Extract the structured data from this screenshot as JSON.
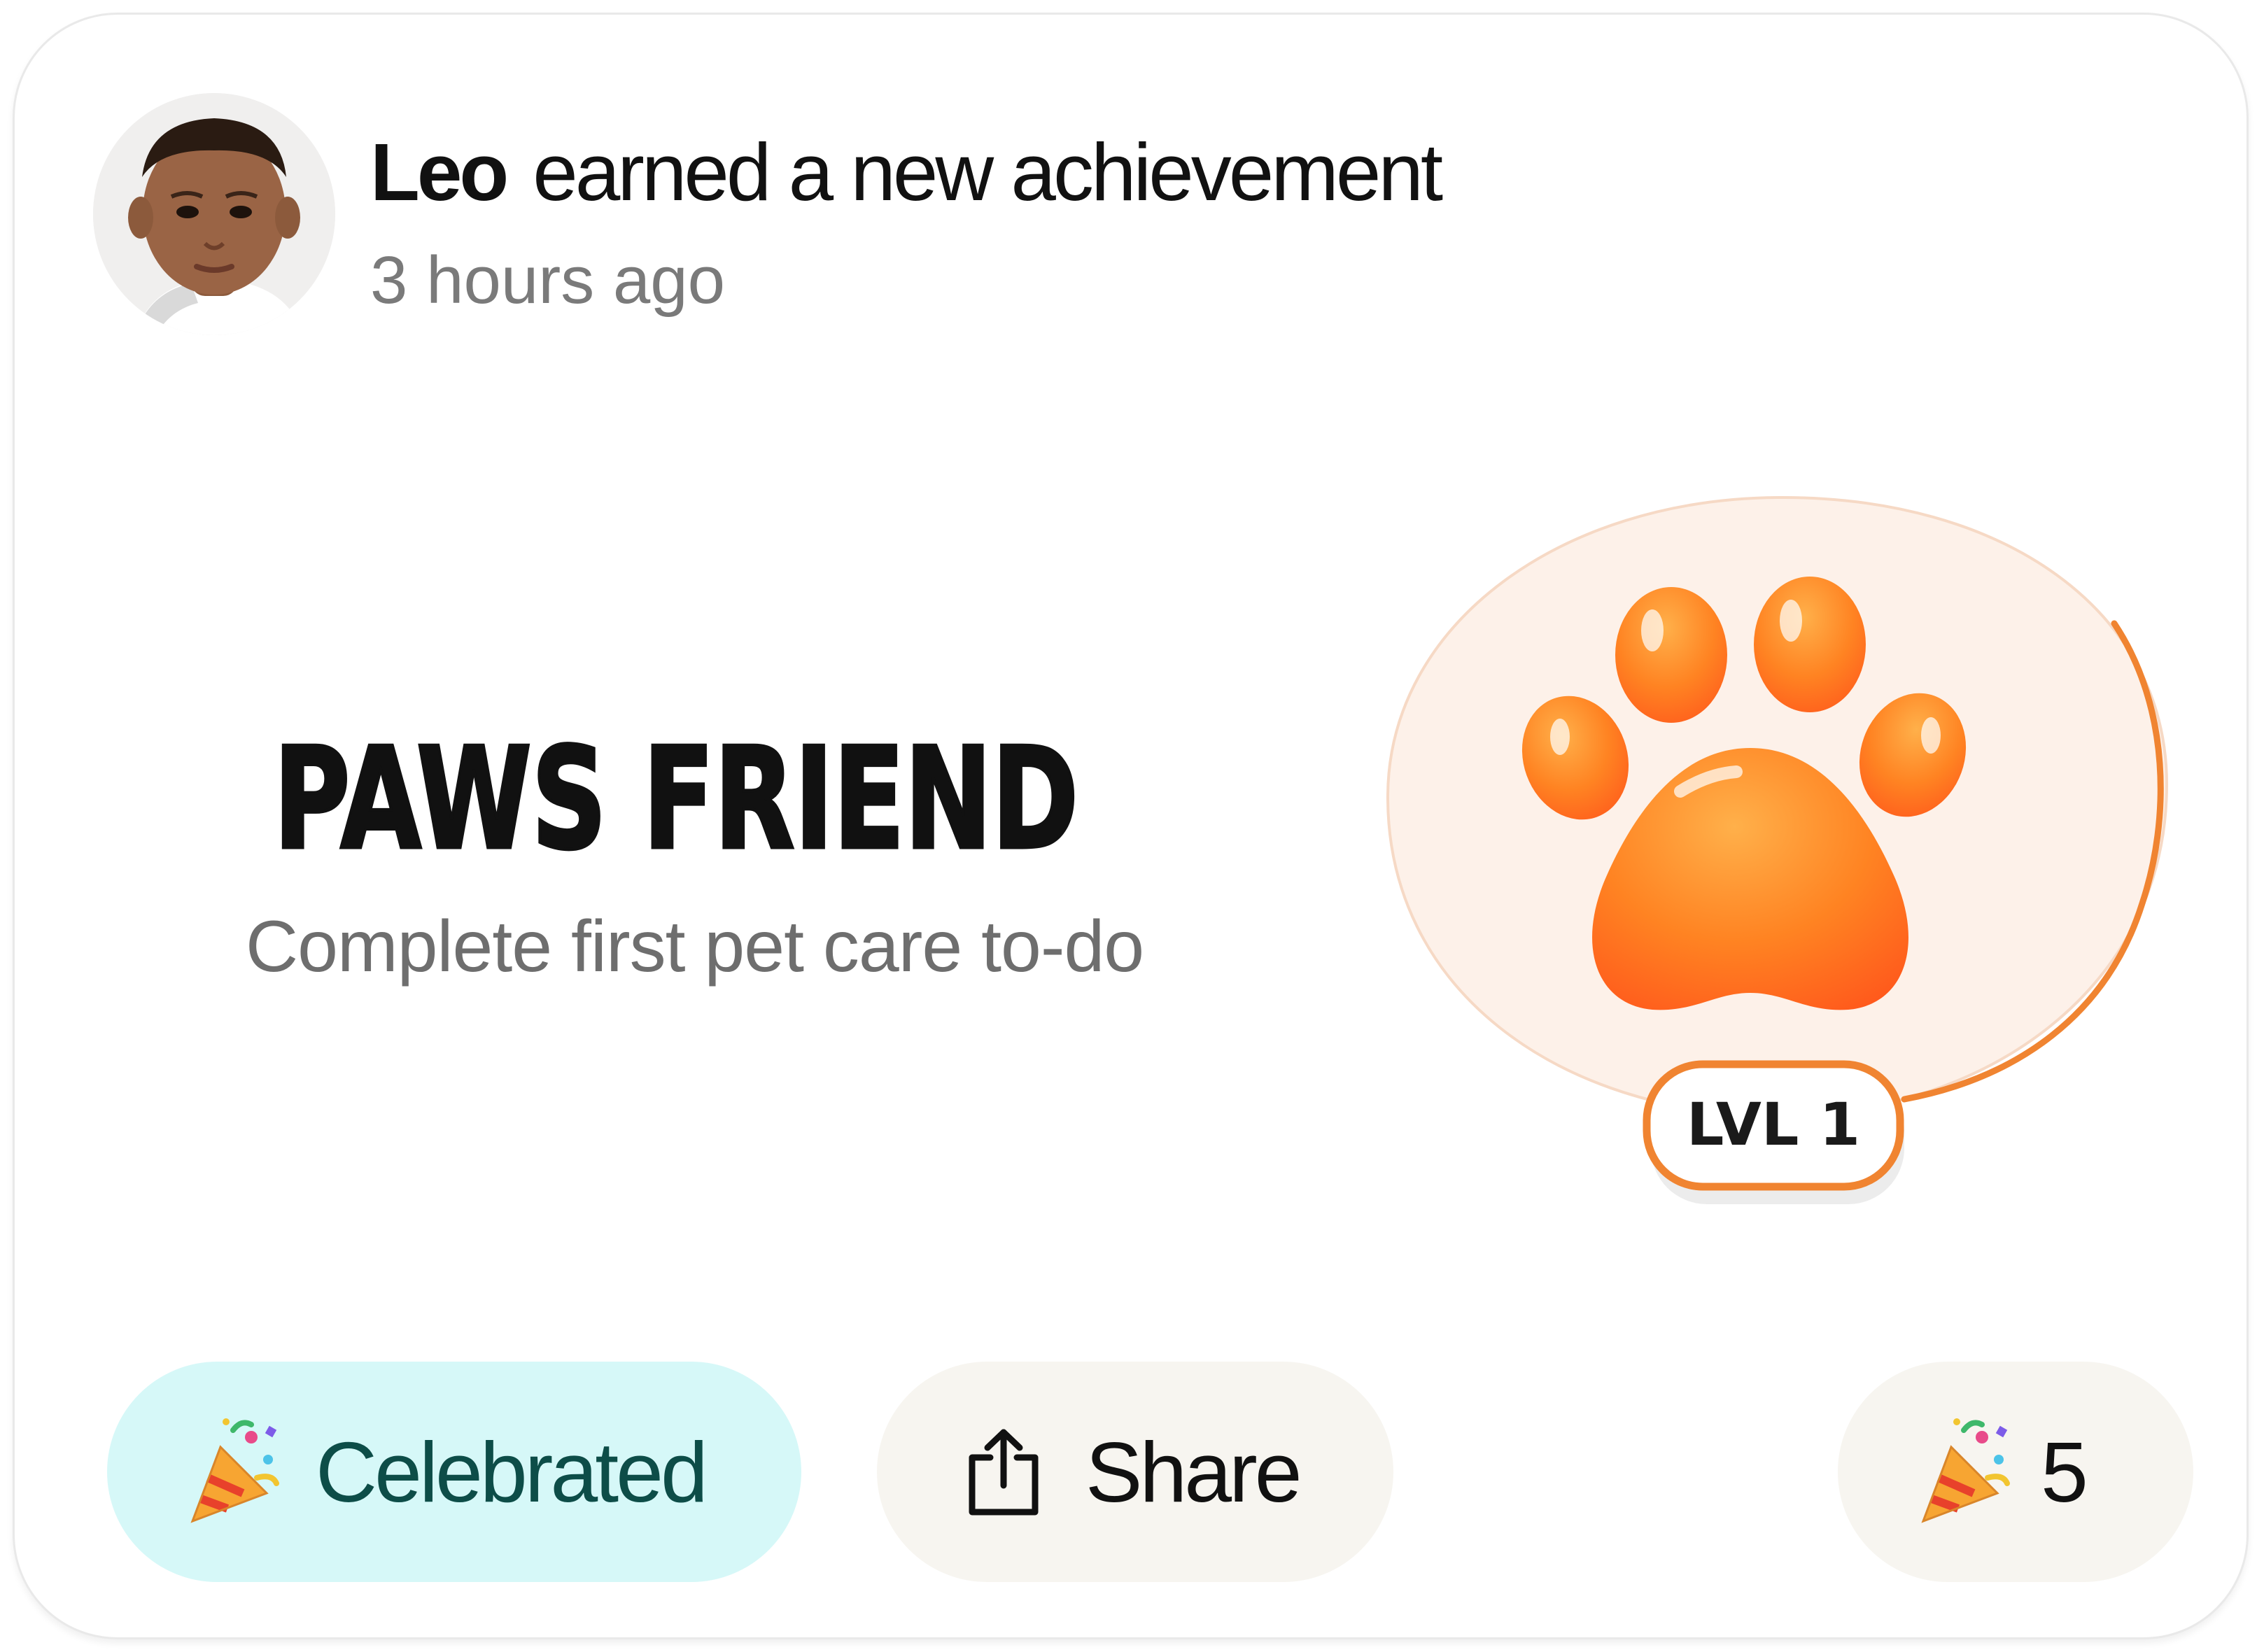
{
  "post": {
    "user_name": "Leo",
    "action_text": "earned a new achievement",
    "timestamp": "3 hours ago",
    "avatar_icon": "child-portrait"
  },
  "achievement": {
    "title": "PAWS FRIEND",
    "description": "Complete first pet care to-do",
    "badge_icon": "paw-icon",
    "level_label": "LVL 1",
    "colors": {
      "badge_background": "#fdf1e9",
      "badge_ring": "#f08431",
      "paw_orange": "#ff7d1e"
    }
  },
  "actions": {
    "celebrate": {
      "label": "Celebrated",
      "icon": "party-popper-icon",
      "state": "active",
      "colors": {
        "background": "#d6f8f8",
        "text": "#0d4d48"
      }
    },
    "share": {
      "label": "Share",
      "icon": "share-upload-icon",
      "colors": {
        "background": "#f7f5f0",
        "text": "#111111"
      }
    },
    "celebration_count": {
      "value": "5",
      "icon": "party-popper-icon",
      "colors": {
        "background": "#f7f5f0",
        "text": "#111111"
      }
    }
  }
}
